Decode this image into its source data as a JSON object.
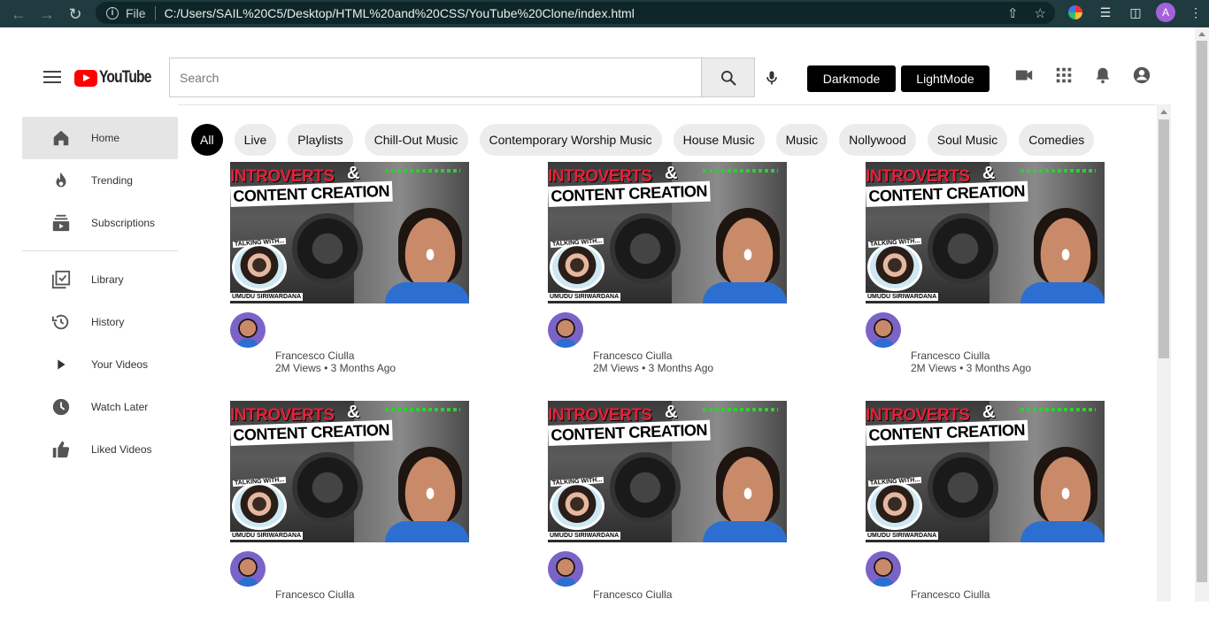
{
  "browser": {
    "file_label": "File",
    "url": "C:/Users/SAIL%20C5/Desktop/HTML%20and%20CSS/YouTube%20Clone/index.html",
    "profile_initial": "A"
  },
  "header": {
    "logo_text": "YouTube",
    "search_placeholder": "Search",
    "darkmode_label": "Darkmode",
    "lightmode_label": "LightMode"
  },
  "sidebar": {
    "items": [
      {
        "label": "Home",
        "icon": "home-icon"
      },
      {
        "label": "Trending",
        "icon": "fire-icon"
      },
      {
        "label": "Subscriptions",
        "icon": "subscriptions-icon"
      },
      {
        "label": "Library",
        "icon": "library-icon"
      },
      {
        "label": "History",
        "icon": "history-icon"
      },
      {
        "label": "Your Videos",
        "icon": "play-icon"
      },
      {
        "label": "Watch Later",
        "icon": "clock-icon"
      },
      {
        "label": "Liked Videos",
        "icon": "thumbs-up-icon"
      }
    ]
  },
  "chips": [
    "All",
    "Live",
    "Playlists",
    "Chill-Out Music",
    "Contemporary Worship Music",
    "House Music",
    "Music",
    "Nollywood",
    "Soul Music",
    "Comedies"
  ],
  "thumbnail": {
    "line1": "INTROVERTS",
    "amp": "&",
    "line2": "CONTENT CREATION",
    "talking": "TALKING WITH...",
    "guest": "UMUDU SIRIWARDANA"
  },
  "videos": [
    {
      "channel": "Francesco Ciulla",
      "stats": "2M Views • 3 Months Ago"
    },
    {
      "channel": "Francesco Ciulla",
      "stats": "2M Views • 3 Months Ago"
    },
    {
      "channel": "Francesco Ciulla",
      "stats": "2M Views • 3 Months Ago"
    },
    {
      "channel": "Francesco Ciulla",
      "stats": ""
    },
    {
      "channel": "Francesco Ciulla",
      "stats": ""
    },
    {
      "channel": "Francesco Ciulla",
      "stats": ""
    }
  ],
  "colors": {
    "brand_red": "#ff0000",
    "chip_active": "#000000",
    "sidebar_active": "#e5e5e5"
  }
}
